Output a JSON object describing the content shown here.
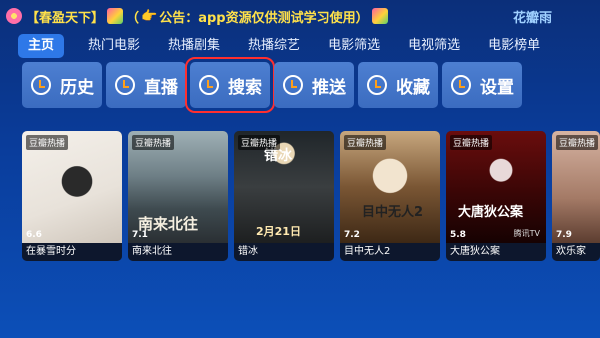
{
  "header": {
    "notice_part1": "【春盈天下】",
    "notice_part2": "（",
    "notice_part3": "公告：app资源仅供测试学习使用）",
    "user_name": "花瓣雨"
  },
  "tabs": [
    "主页",
    "热门电影",
    "热播剧集",
    "热播综艺",
    "电影筛选",
    "电视筛选",
    "电影榜单"
  ],
  "functions": [
    {
      "label": "历史",
      "icon": "history-icon"
    },
    {
      "label": "直播",
      "icon": "live-icon"
    },
    {
      "label": "搜索",
      "icon": "search-icon",
      "focused": true
    },
    {
      "label": "推送",
      "icon": "push-icon"
    },
    {
      "label": "收藏",
      "icon": "favorite-icon"
    },
    {
      "label": "设置",
      "icon": "settings-icon"
    }
  ],
  "posters": [
    {
      "source": "豆瓣热播",
      "score": "6.6",
      "title": "在暴雪时分"
    },
    {
      "source": "豆瓣热播",
      "score": "7.1",
      "title": "南来北往",
      "art_text": "南来北往"
    },
    {
      "source": "豆瓣热播",
      "score": "",
      "title": "错冰",
      "art_text": "错冰",
      "date": "2月21日"
    },
    {
      "source": "豆瓣热播",
      "score": "7.2",
      "title": "目中无人2",
      "art_text": "目中无人2"
    },
    {
      "source": "豆瓣热播",
      "score": "5.8",
      "title": "大唐狄公案",
      "art_text": "大唐狄公案",
      "platform": "腾讯TV"
    },
    {
      "source": "豆瓣热播",
      "score": "7.9",
      "title": "欢乐家"
    }
  ],
  "colors": {
    "accent": "#2e78e8",
    "focus": "#ff2f2f",
    "notice": "#ffe14a"
  }
}
